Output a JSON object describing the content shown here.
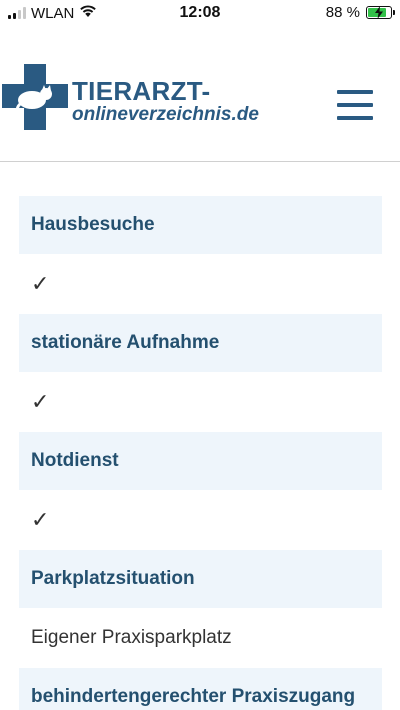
{
  "status_bar": {
    "carrier": "WLAN",
    "time": "12:08",
    "battery_percent": "88 %",
    "battery_level": 0.88,
    "battery_color": "#33c24a"
  },
  "header": {
    "logo_title": "TIERARZT-",
    "logo_subtitle": "onlineverzeichnis.de"
  },
  "colors": {
    "brand": "#2a5a82",
    "row_background": "#eef5fb"
  },
  "details": [
    {
      "label": "Hausbesuche",
      "value": "✓"
    },
    {
      "label": "stationäre Aufnahme",
      "value": "✓"
    },
    {
      "label": "Notdienst",
      "value": "✓"
    },
    {
      "label": "Parkplatzsituation",
      "value": "Eigener Praxisparkplatz"
    },
    {
      "label": "behindertengerechter Praxiszugang",
      "value": ""
    }
  ]
}
